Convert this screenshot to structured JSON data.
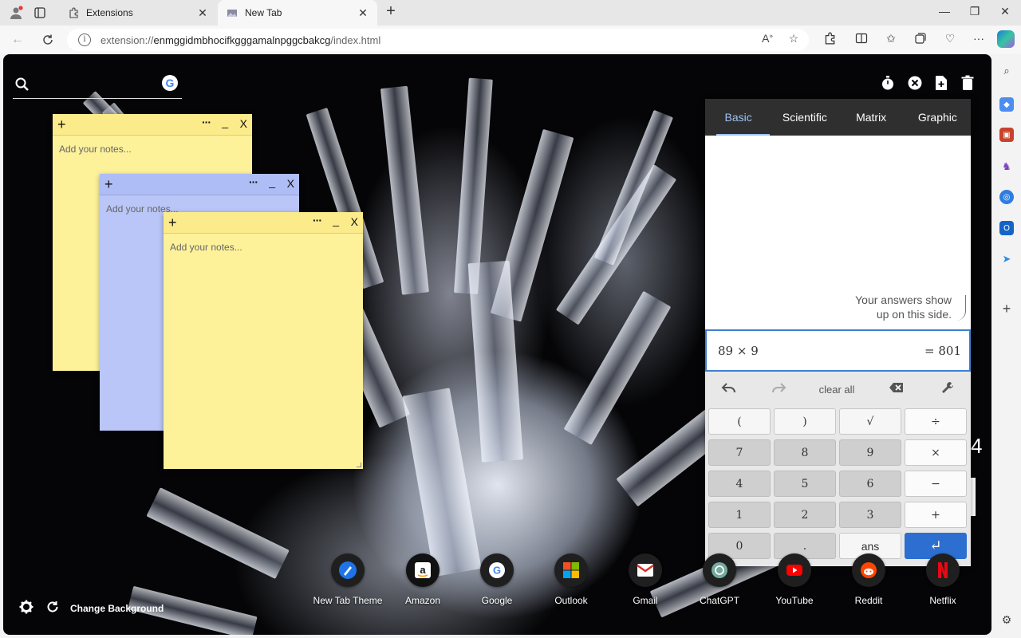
{
  "browser": {
    "tabs": [
      {
        "title": "Extensions",
        "icon": "extension-puzzle-icon",
        "active": false
      },
      {
        "title": "New Tab",
        "icon": "new-tab-theme-icon",
        "active": true
      }
    ],
    "address": {
      "prefix": "extension://",
      "host": "enmggidmbhocifkgggamalnpggcbakcg",
      "path": "/index.html"
    }
  },
  "page": {
    "search": {
      "placeholder": ""
    },
    "notes": [
      {
        "color": "yellow",
        "placeholder": "Add your notes...",
        "more": "···",
        "minimize": "_",
        "close": "X",
        "add": "+"
      },
      {
        "color": "blue",
        "placeholder": "Add your notes...",
        "more": "···",
        "minimize": "_",
        "close": "X",
        "add": "+"
      },
      {
        "color": "yellow",
        "placeholder": "Add your notes...",
        "more": "···",
        "minimize": "_",
        "close": "X",
        "add": "+"
      }
    ],
    "calculator": {
      "tabs": [
        "Basic",
        "Scientific",
        "Matrix",
        "Graphic"
      ],
      "selected_tab": "Basic",
      "hint_line1": "Your answers show",
      "hint_line2": "up on this side.",
      "expression": "89 × 9",
      "result": "= 801",
      "clear_all": "clear all",
      "keys": {
        "row1": [
          "(",
          ")",
          "√",
          "÷"
        ],
        "row2": [
          "7",
          "8",
          "9",
          "×"
        ],
        "row3": [
          "4",
          "5",
          "6",
          "−"
        ],
        "row4": [
          "1",
          "2",
          "3",
          "+"
        ],
        "row5": [
          "0",
          ".",
          "ans",
          "↵"
        ]
      }
    },
    "clock_fragment": "4",
    "shortcuts": [
      {
        "label": "New Tab Theme",
        "icon": "new-tab-theme-icon"
      },
      {
        "label": "Amazon",
        "icon": "amazon-icon"
      },
      {
        "label": "Google",
        "icon": "google-icon"
      },
      {
        "label": "Outlook",
        "icon": "outlook-icon"
      },
      {
        "label": "Gmail",
        "icon": "gmail-icon"
      },
      {
        "label": "ChatGPT",
        "icon": "chatgpt-icon"
      },
      {
        "label": "YouTube",
        "icon": "youtube-icon"
      },
      {
        "label": "Reddit",
        "icon": "reddit-icon"
      },
      {
        "label": "Netflix",
        "icon": "netflix-icon"
      }
    ],
    "change_background": "Change Background"
  },
  "colors": {
    "accent": "#2c6fd1",
    "calc_tab_bg": "#2f2f2f",
    "calc_tab_selected": "#9ec3f5",
    "note_yellow": "#fdf19a",
    "note_blue": "#b9c6f7"
  }
}
